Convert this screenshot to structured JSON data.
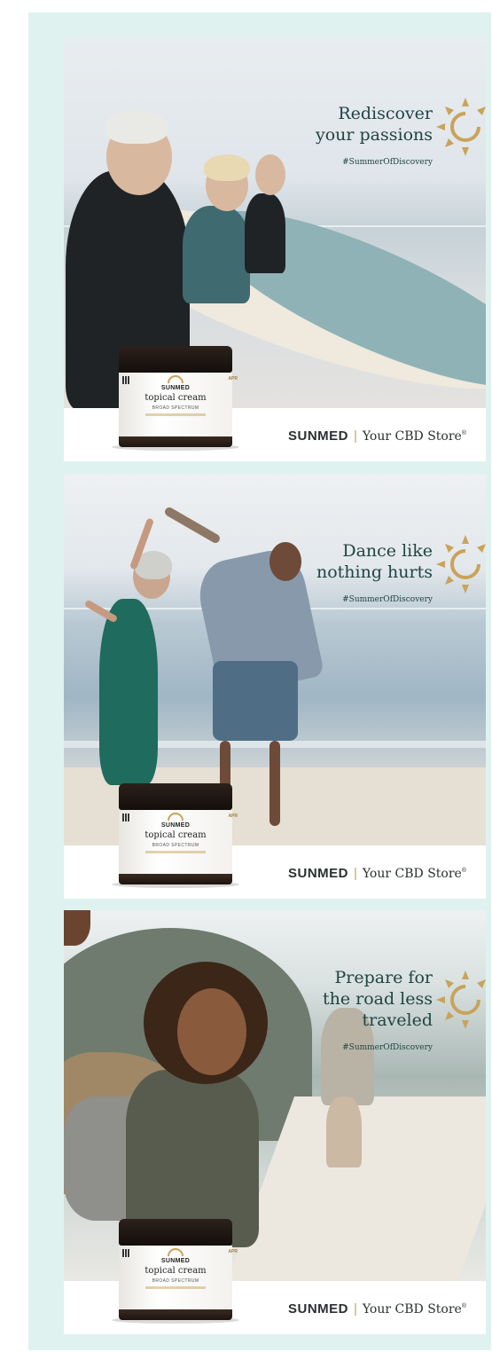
{
  "ads": [
    {
      "headline_lines": [
        "Rediscover",
        "your passions"
      ],
      "hashtag": "#SummerOfDiscovery"
    },
    {
      "headline_lines": [
        "Dance like",
        "nothing hurts"
      ],
      "hashtag": "#SummerOfDiscovery"
    },
    {
      "headline_lines": [
        "Prepare for",
        "the road less",
        "traveled"
      ],
      "hashtag": "#SummerOfDiscovery"
    }
  ],
  "brand": {
    "name": "SUNMED",
    "separator": "|",
    "tagline": "Your CBD Store",
    "trademark": "®"
  },
  "jar": {
    "brand": "SUNMED",
    "product": "topical cream",
    "spectrum": "BROAD SPECTRUM",
    "side_mark": "APR"
  },
  "colors": {
    "frame_background": "#dff2ef",
    "headline": "#21443f",
    "accent_gold": "#c9a35a"
  },
  "icons": {
    "sun": "sun-icon",
    "jar_emblem": "sun-emblem-icon"
  }
}
